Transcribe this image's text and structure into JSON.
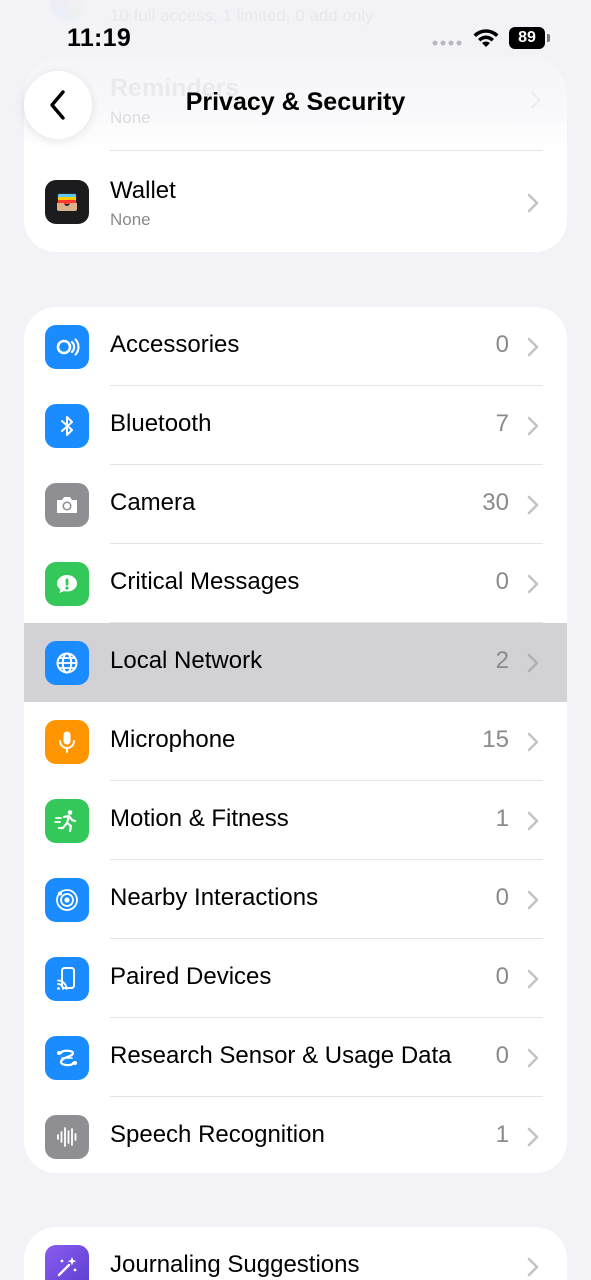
{
  "status_bar": {
    "time": "11:19",
    "battery": "89"
  },
  "nav": {
    "title": "Privacy & Security",
    "back_icon": "chevron-left-icon"
  },
  "background_items": {
    "top_partial_text": "10 full access, 1 limited, 0 add only",
    "reminders_label": "Reminders",
    "reminders_value": "None"
  },
  "wallet": {
    "label": "Wallet",
    "value": "None",
    "icon": "wallet-icon"
  },
  "items": [
    {
      "label": "Accessories",
      "count": "0",
      "icon": "accessories-icon",
      "color": "#1a8cff"
    },
    {
      "label": "Bluetooth",
      "count": "7",
      "icon": "bluetooth-icon",
      "color": "#1a8cff"
    },
    {
      "label": "Camera",
      "count": "30",
      "icon": "camera-icon",
      "color": "#8e8e93"
    },
    {
      "label": "Critical Messages",
      "count": "0",
      "icon": "critical-messages-icon",
      "color": "#34c759"
    },
    {
      "label": "Local Network",
      "count": "2",
      "icon": "globe-icon",
      "color": "#1a8cff",
      "highlighted": true
    },
    {
      "label": "Microphone",
      "count": "15",
      "icon": "microphone-icon",
      "color": "#ff9500"
    },
    {
      "label": "Motion & Fitness",
      "count": "1",
      "icon": "motion-fitness-icon",
      "color": "#34c759"
    },
    {
      "label": "Nearby Interactions",
      "count": "0",
      "icon": "nearby-interactions-icon",
      "color": "#1a8cff"
    },
    {
      "label": "Paired Devices",
      "count": "0",
      "icon": "paired-devices-icon",
      "color": "#1a8cff"
    },
    {
      "label": "Research Sensor & Usage Data",
      "count": "0",
      "icon": "research-sensor-icon",
      "color": "#1a8cff"
    },
    {
      "label": "Speech Recognition",
      "count": "1",
      "icon": "speech-recognition-icon",
      "color": "#8e8e93"
    }
  ],
  "journaling": {
    "label": "Journaling Suggestions",
    "icon": "journaling-suggestions-icon",
    "color": "#6e4bd8"
  }
}
